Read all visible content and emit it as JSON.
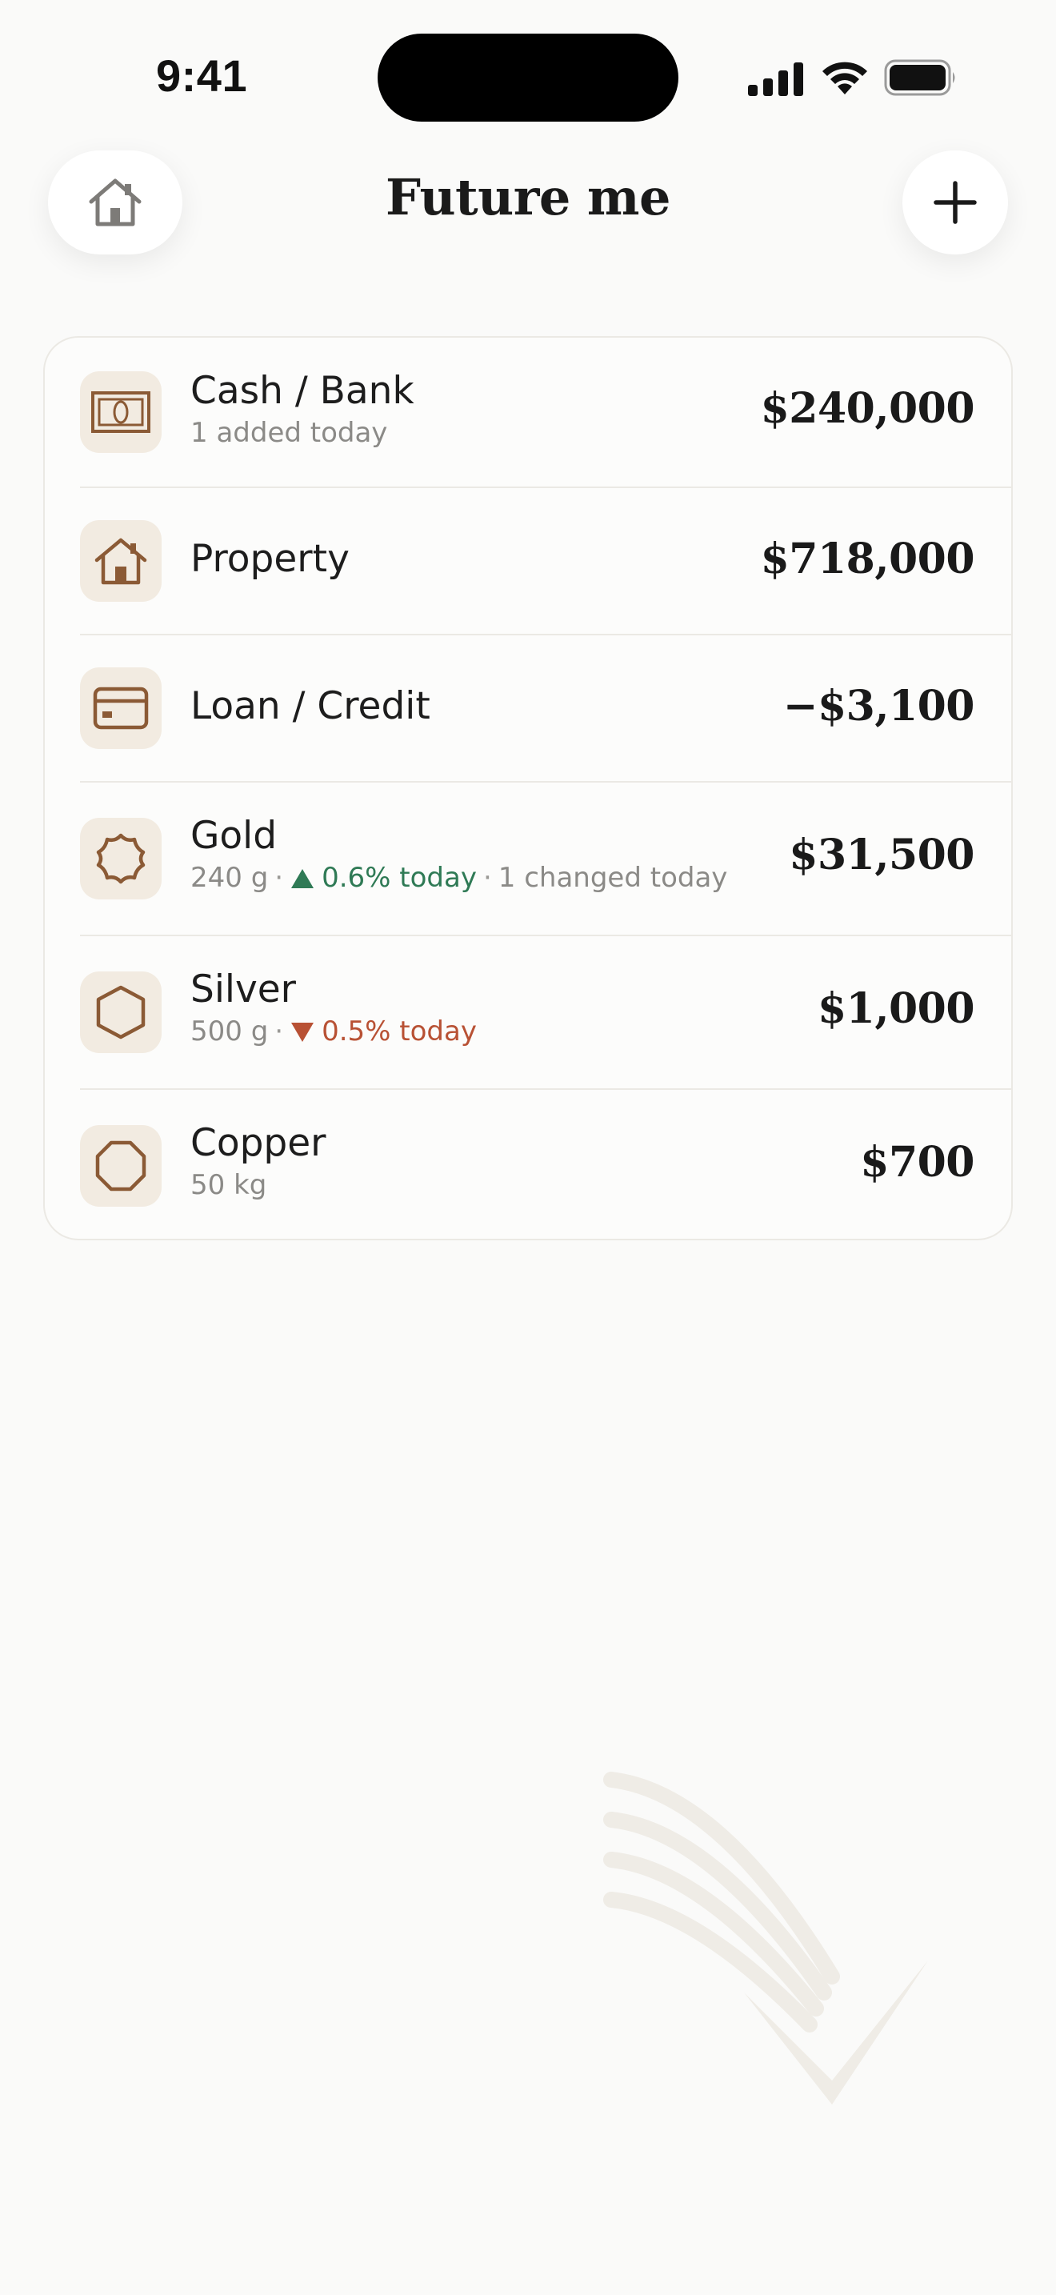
{
  "status_bar": {
    "time": "9:41",
    "icons": [
      "signal-icon",
      "wifi-icon",
      "battery-icon"
    ]
  },
  "header": {
    "title": "Future me",
    "home_icon": "home-icon",
    "add_icon": "plus-icon"
  },
  "assets": [
    {
      "icon": "banknote-icon",
      "name": "Cash / Bank",
      "subtitle": "1 added today",
      "value": "$240,000"
    },
    {
      "icon": "house-icon",
      "name": "Property",
      "subtitle": "",
      "value": "$718,000"
    },
    {
      "icon": "credit-card-icon",
      "name": "Loan / Credit",
      "subtitle": "",
      "value": "−$3,100"
    },
    {
      "icon": "gold-seal-icon",
      "name": "Gold",
      "sub_qty": "240 g",
      "sub_change": "0.6% today",
      "sub_change_dir": "up",
      "sub_note": "1 changed today",
      "value": "$31,500"
    },
    {
      "icon": "hexagon-icon",
      "name": "Silver",
      "sub_qty": "500 g",
      "sub_change": "0.5% today",
      "sub_change_dir": "down",
      "value": "$1,000"
    },
    {
      "icon": "octagon-icon",
      "name": "Copper",
      "subtitle": "50 kg",
      "value": "$700"
    }
  ],
  "colors": {
    "background": "#fafaf9",
    "icon_tile": "#f2ebe1",
    "icon_stroke": "#8b5a35",
    "positive": "#2f7a55",
    "negative": "#b85134"
  }
}
